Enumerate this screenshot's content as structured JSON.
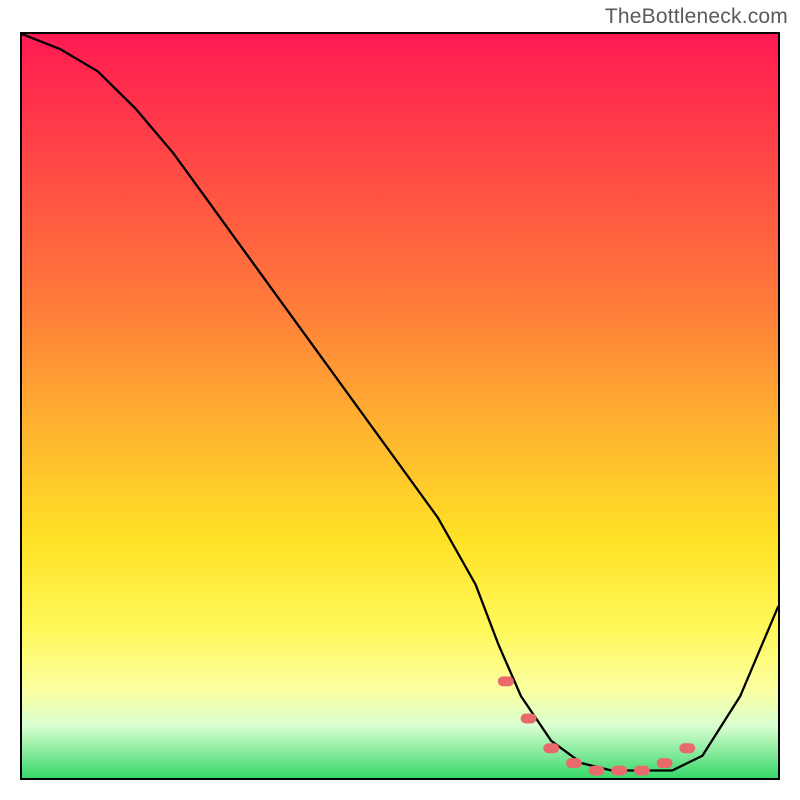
{
  "watermark": "TheBottleneck.com",
  "chart_data": {
    "type": "line",
    "title": "",
    "xlabel": "",
    "ylabel": "",
    "xlim": [
      0,
      100
    ],
    "ylim": [
      0,
      100
    ],
    "grid": false,
    "legend": false,
    "background": "heatmap-gradient-red-to-green",
    "series": [
      {
        "name": "bottleneck-curve",
        "x": [
          0,
          5,
          10,
          15,
          20,
          25,
          30,
          35,
          40,
          45,
          50,
          55,
          60,
          63,
          66,
          70,
          74,
          78,
          82,
          86,
          90,
          95,
          100
        ],
        "y": [
          100,
          98,
          95,
          90,
          84,
          77,
          70,
          63,
          56,
          49,
          42,
          35,
          26,
          18,
          11,
          5,
          2,
          1,
          1,
          1,
          3,
          11,
          23
        ]
      }
    ],
    "markers": {
      "name": "highlighted-points",
      "x": [
        64,
        67,
        70,
        73,
        76,
        79,
        82,
        85,
        88
      ],
      "y": [
        13,
        8,
        4,
        2,
        1,
        1,
        1,
        2,
        4
      ]
    }
  }
}
